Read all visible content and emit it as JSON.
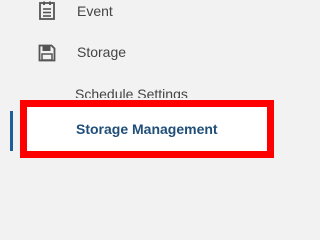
{
  "sidebar": {
    "items": [
      {
        "label": "Event",
        "icon": "calendar-list-icon"
      },
      {
        "label": "Storage",
        "icon": "floppy-disk-icon"
      }
    ],
    "subitems": [
      {
        "label": "Schedule Settings"
      },
      {
        "label": "Storage Management",
        "active": true
      }
    ]
  },
  "colors": {
    "background": "#f2f2f2",
    "text": "#444444",
    "active_text": "#1f4e79",
    "active_bar": "#1f5f99",
    "highlight": "#ff0000"
  }
}
